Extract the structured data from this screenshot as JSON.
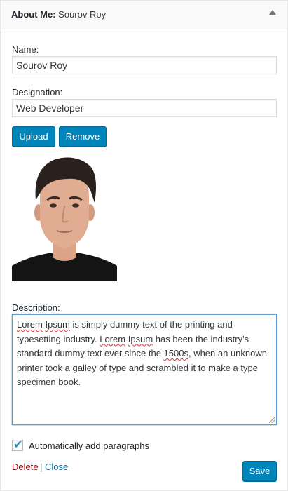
{
  "widget": {
    "title_label": "About Me:",
    "title_value": "Sourov Roy"
  },
  "fields": {
    "name_label": "Name:",
    "name_value": "Sourov Roy",
    "designation_label": "Designation:",
    "designation_value": "Web Developer",
    "description_label": "Description:",
    "description_parts": [
      "Lorem",
      " ",
      "Ipsum",
      " is simply dummy text of the printing and typesetting industry. ",
      "Lorem",
      " ",
      "Ipsum",
      " has been the industry's standard dummy text ever since the ",
      "1500s",
      ", when an unknown printer took a galley of type and scrambled it to make a type specimen book."
    ]
  },
  "buttons": {
    "upload_label": "Upload",
    "remove_label": "Remove",
    "save_label": "Save"
  },
  "options": {
    "auto_paragraphs_label": "Automatically add paragraphs",
    "auto_paragraphs_checked": true
  },
  "links": {
    "delete_label": "Delete",
    "separator": "|",
    "close_label": "Close"
  },
  "colors": {
    "primary_button": "#0085ba",
    "delete_link": "#a00",
    "close_link": "#0073aa",
    "focus_border": "#5b9dd9"
  },
  "icons": {
    "collapse": "triangle-up",
    "checkbox": "checkmark"
  }
}
